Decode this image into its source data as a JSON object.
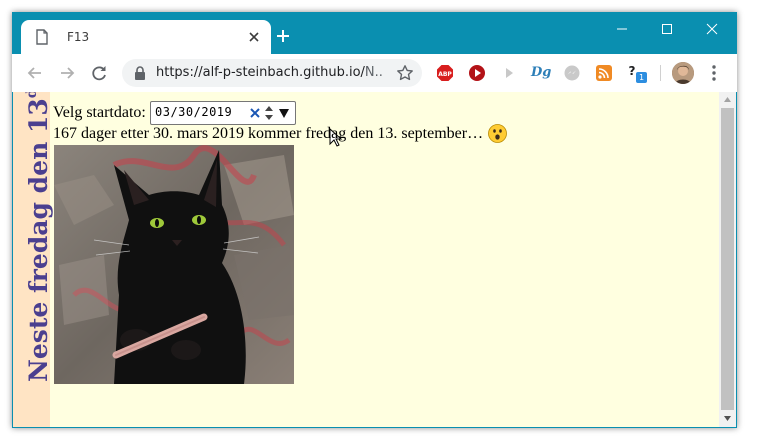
{
  "browser": {
    "tab_title": "F13",
    "url_main": "https://alf-p-steinbach.github.io/",
    "url_rest": "N...",
    "extensions": {
      "abp_label": "ABP",
      "dg_label": "Dg",
      "help_label": "?",
      "help_badge": "1"
    }
  },
  "page": {
    "side_title": "Neste fredag den 13",
    "side_title_sup": "de",
    "date_label": "Velg startdato:",
    "date_value": "03/30/2019",
    "result_text": "167 dager etter 30. mars 2019 kommer fredag den 13. september…",
    "emoji": "astonished-face"
  },
  "colors": {
    "frame": "#0a8fb0",
    "page_background": "#ffffe0",
    "side_band": "#ffe4c4",
    "side_text": "#4b3f8f"
  }
}
